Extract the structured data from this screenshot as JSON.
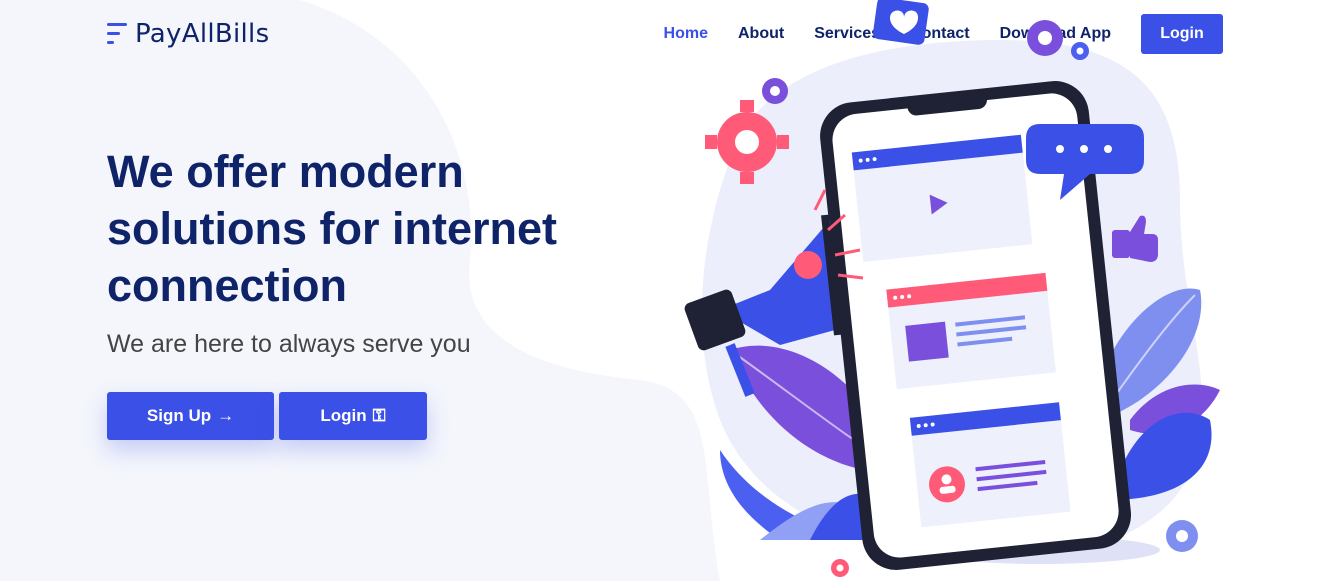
{
  "brand": {
    "name": "PayAllBills",
    "accent": "#3b50e6",
    "navy": "#0e2368"
  },
  "nav": {
    "items": [
      {
        "label": "Home",
        "active": true
      },
      {
        "label": "About"
      },
      {
        "label": "Services"
      },
      {
        "label": "Contact"
      },
      {
        "label": "Download App"
      }
    ],
    "login_label": "Login"
  },
  "hero": {
    "title": "We offer modern solutions for internet connection",
    "subtitle": "We are here to always serve you",
    "signup_label": "Sign Up",
    "signup_icon": "→",
    "login_label": "Login",
    "login_icon": "⚿"
  },
  "illustration": {
    "icons": [
      "heart-chat-icon",
      "gear-icon",
      "megaphone-icon",
      "smartphone-icon",
      "thumbs-up-icon",
      "chat-bubble-icon",
      "play-icon",
      "user-icon"
    ],
    "colors": {
      "pink": "#ff5a78",
      "purple": "#7c4ddf",
      "blue": "#3b50e6",
      "light": "#eef0fb"
    }
  }
}
